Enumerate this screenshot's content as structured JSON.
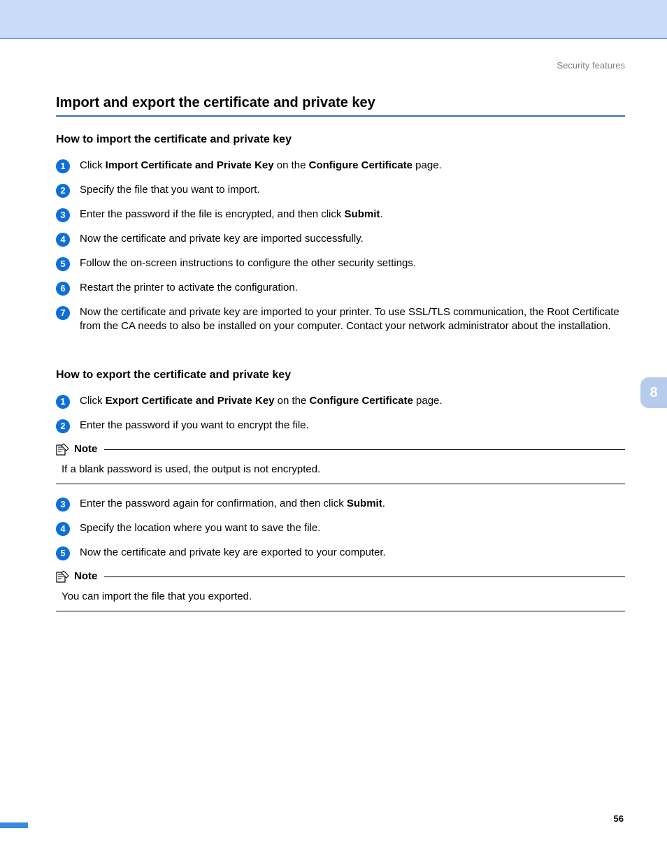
{
  "header": "Security features",
  "chapter": "8",
  "pageNumber": "56",
  "mainTitle": "Import and export the certificate and private key",
  "section1": {
    "title": "How to import the certificate and private key",
    "steps": [
      {
        "num": "1",
        "pre": "Click ",
        "b1": "Import Certificate and Private Key",
        "mid": " on the ",
        "b2": "Configure Certificate",
        "post": " page."
      },
      {
        "num": "2",
        "text": "Specify the file that you want to import."
      },
      {
        "num": "3",
        "pre": "Enter the password if the file is encrypted, and then click ",
        "b1": "Submit",
        "post": "."
      },
      {
        "num": "4",
        "text": "Now the certificate and private key are imported successfully."
      },
      {
        "num": "5",
        "text": "Follow the on-screen instructions to configure the other security settings."
      },
      {
        "num": "6",
        "text": "Restart the printer to activate the configuration."
      },
      {
        "num": "7",
        "text": "Now the certificate and private key are imported to your printer. To use SSL/TLS communication, the Root Certificate from the CA needs to also be installed on your computer. Contact your network administrator about the installation."
      }
    ]
  },
  "section2": {
    "title": "How to export the certificate and private key",
    "stepsA": [
      {
        "num": "1",
        "pre": "Click ",
        "b1": "Export Certificate and Private Key",
        "mid": " on the ",
        "b2": "Configure Certificate",
        "post": " page."
      },
      {
        "num": "2",
        "text": "Enter the password if you want to encrypt the file."
      }
    ],
    "note1": {
      "label": "Note",
      "body": "If a blank password is used, the output is not encrypted."
    },
    "stepsB": [
      {
        "num": "3",
        "pre": "Enter the password again for confirmation, and then click ",
        "b1": "Submit",
        "post": "."
      },
      {
        "num": "4",
        "text": "Specify the location where you want to save the file."
      },
      {
        "num": "5",
        "text": "Now the certificate and private key are exported to your computer."
      }
    ],
    "note2": {
      "label": "Note",
      "body": "You can import the file that you exported."
    }
  }
}
